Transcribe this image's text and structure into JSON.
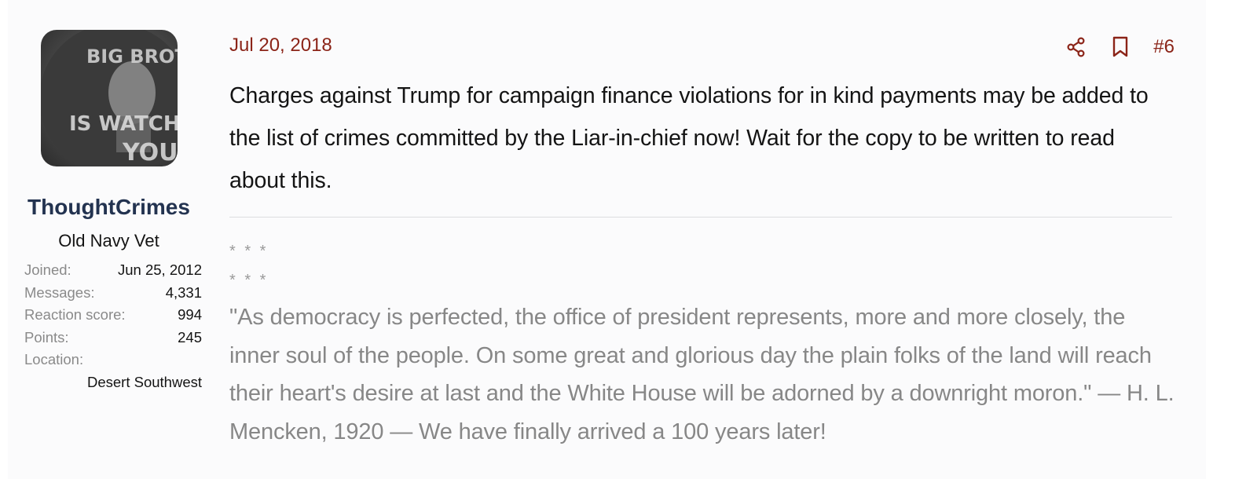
{
  "user": {
    "username": "ThoughtCrimes",
    "user_title": "Old Navy Vet",
    "avatar_text": "BIG BROTHER IS WATCHING YOU",
    "stats": [
      {
        "label": "Joined:",
        "value": "Jun 25, 2012"
      },
      {
        "label": "Messages:",
        "value": "4,331"
      },
      {
        "label": "Reaction score:",
        "value": "994"
      },
      {
        "label": "Points:",
        "value": "245"
      }
    ],
    "location_label": "Location:",
    "location_value": "Desert Southwest"
  },
  "post": {
    "date": "Jul 20, 2018",
    "number": "#6",
    "share_icon": "share-icon",
    "bookmark_icon": "bookmark-icon",
    "body": "Charges against Trump for campaign finance violations for in kind payments may be added to the list of crimes committed by the Liar-in-chief now! Wait for the copy to be written to read about this."
  },
  "signature": {
    "stars_1": "* * *",
    "stars_2": "* * *",
    "quote": "\"As democracy is perfected, the office of president represents, more and more closely, the inner soul of the people. On some great and glorious day the plain folks of the land will reach their heart's desire at last and the White House will be adorned by a downright moron.\" — H. L. Mencken, 1920 — We have finally arrived a 100 years later!"
  },
  "colors": {
    "accent": "#8b2418",
    "username": "#233350",
    "muted": "#8a8a8a"
  }
}
